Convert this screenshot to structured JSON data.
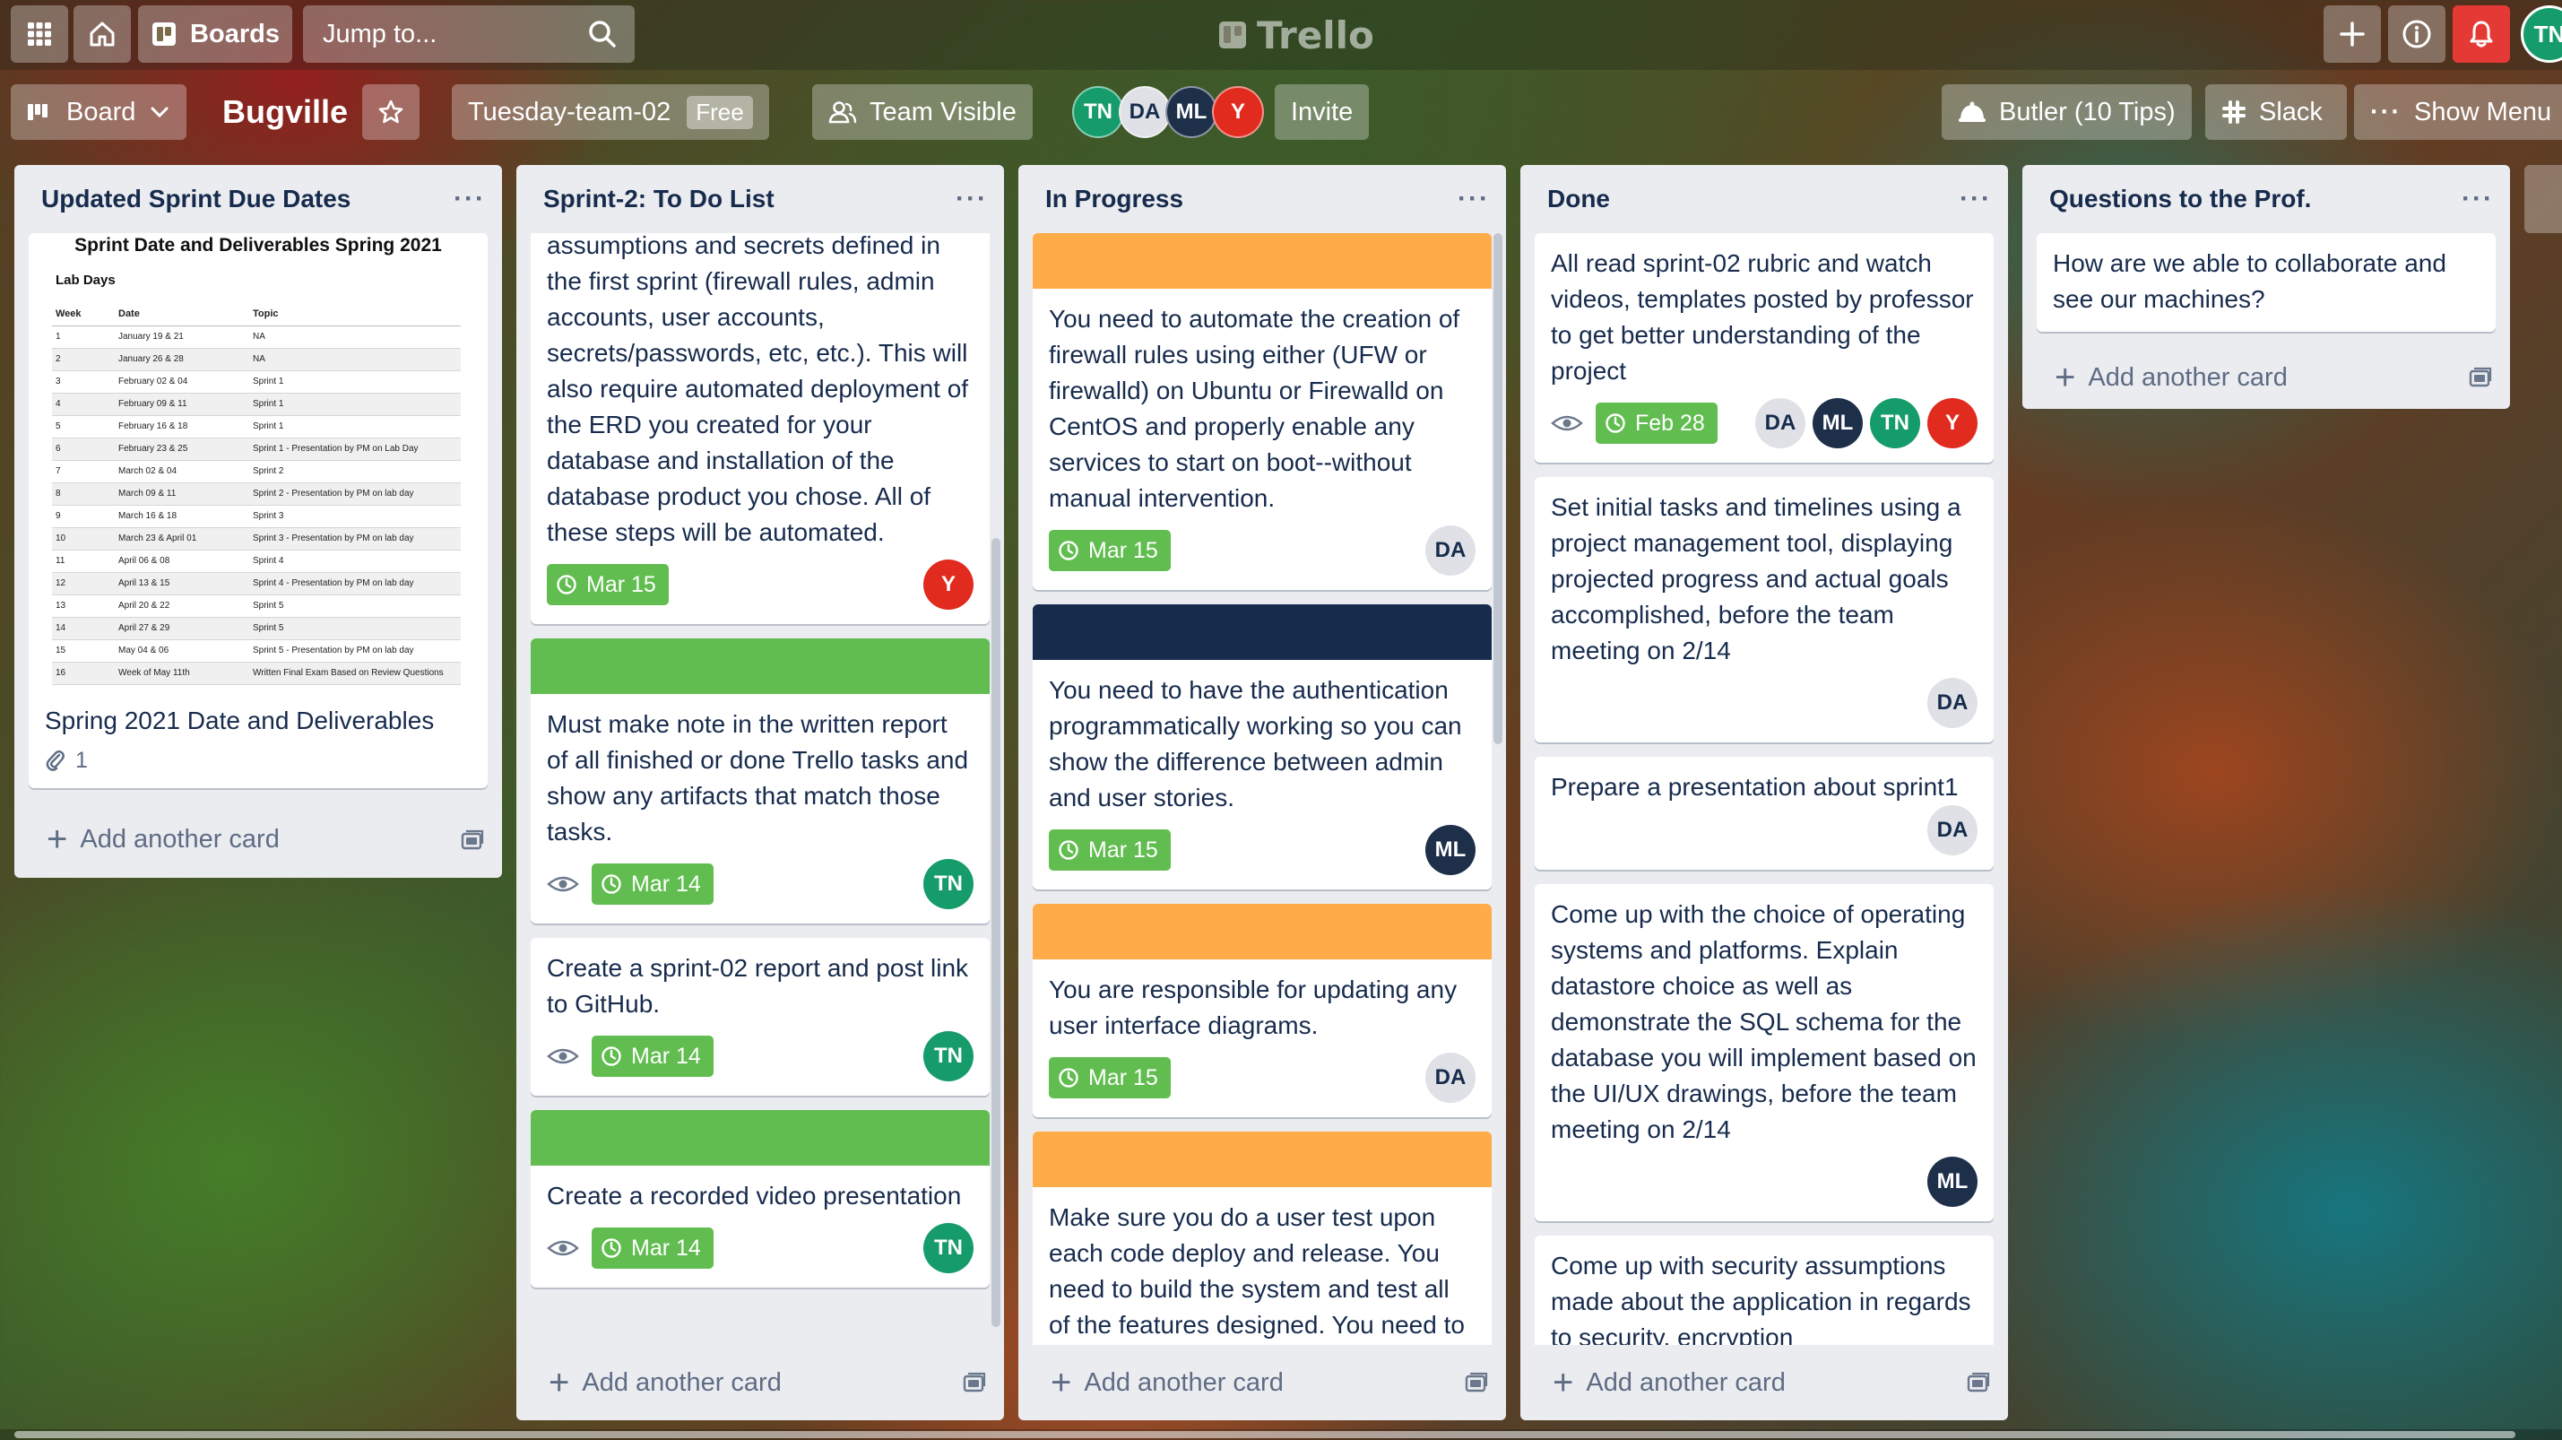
{
  "header": {
    "boards_label": "Boards",
    "search_placeholder": "Jump to...",
    "logo_text": "Trello",
    "user_initials": "TN"
  },
  "board": {
    "view_label": "Board",
    "name": "Bugville",
    "team_name": "Tuesday-team-02",
    "team_plan": "Free",
    "visibility": "Team Visible",
    "members": [
      {
        "initials": "TN",
        "color": "#169c6a"
      },
      {
        "initials": "DA",
        "color": "#dfe1e6"
      },
      {
        "initials": "ML",
        "color": "#1e2f4a"
      },
      {
        "initials": "Y",
        "color": "#e02b1e"
      }
    ],
    "invite_label": "Invite",
    "butler_label": "Butler (10 Tips)",
    "slack_label": "Slack",
    "menu_label": "Show Menu"
  },
  "colors": {
    "label_orange": "#ffab4a",
    "label_navy": "#172b4d",
    "label_green": "#61bd4f",
    "due_green": "#61bd4f",
    "avatar_tn": "#169c6a",
    "avatar_ml": "#1e2f4a",
    "avatar_y": "#e02b1e",
    "avatar_da": "#dfe1e6"
  },
  "lists": [
    {
      "title": "Updated Sprint Due Dates",
      "add_label": "Add another card",
      "schedule": {
        "title": "Sprint Date and Deliverables Spring 2021",
        "subtitle": "Lab Days",
        "columns": [
          "Week",
          "Date",
          "Topic"
        ],
        "rows": [
          [
            "1",
            "January 19 & 21",
            "NA"
          ],
          [
            "2",
            "January 26 & 28",
            "NA"
          ],
          [
            "3",
            "February 02 & 04",
            "Sprint 1"
          ],
          [
            "4",
            "February 09 & 11",
            "Sprint 1"
          ],
          [
            "5",
            "February 16 & 18",
            "Sprint 1"
          ],
          [
            "6",
            "February 23 & 25",
            "Sprint 1 - Presentation by PM on Lab Day"
          ],
          [
            "7",
            "March 02 & 04",
            "Sprint 2"
          ],
          [
            "8",
            "March 09 & 11",
            "Sprint 2 - Presentation by PM on lab day"
          ],
          [
            "9",
            "March 16 & 18",
            "Sprint 3"
          ],
          [
            "10",
            "March 23 & April 01",
            "Sprint 3 - Presentation by PM on lab day"
          ],
          [
            "11",
            "April 06 & 08",
            "Sprint 4"
          ],
          [
            "12",
            "April 13 & 15",
            "Sprint 4 - Presentation by PM on lab day"
          ],
          [
            "13",
            "April 20 & 22",
            "Sprint 5"
          ],
          [
            "14",
            "April 27 & 29",
            "Sprint 5"
          ],
          [
            "15",
            "May 04 & 06",
            "Sprint 5 - Presentation by PM on lab day"
          ],
          [
            "16",
            "Week of May 11th",
            "Written Final Exam Based on Review Questions"
          ]
        ]
      },
      "card_title": "Spring 2021 Date and Deliverables",
      "attachments": "1"
    },
    {
      "title": "Sprint-2: To Do List",
      "add_label": "Add another card",
      "cards": [
        {
          "text": "assumptions and secrets defined in the first sprint (firewall rules, admin accounts, user accounts, secrets/passwords, etc, etc.). This will also require automated deployment of the ERD you created for your database and installation of the database product you chose. All of these steps will be automated.",
          "due": "Mar 15",
          "member": "Y"
        },
        {
          "text": "Must make note in the written report of all finished or done Trello tasks and show any artifacts that match those tasks.",
          "due": "Mar 14",
          "member": "TN"
        },
        {
          "text": "Create a sprint-02 report and post link to GitHub.",
          "due": "Mar 14",
          "member": "TN"
        },
        {
          "text": "Create a recorded video presentation",
          "due": "Mar 14",
          "member": "TN"
        }
      ]
    },
    {
      "title": "In Progress",
      "add_label": "Add another card",
      "cards": [
        {
          "text": "You need to automate the creation of firewall rules using either (UFW or firewalld) on Ubuntu or Firewalld on CentOS and properly enable any services to start on boot--without manual intervention.",
          "due": "Mar 15",
          "member": "DA"
        },
        {
          "text": "You need to have the authentication programmatically working so you can show the difference between admin and user stories.",
          "due": "Mar 15",
          "member": "ML"
        },
        {
          "text": "You are responsible for updating any user interface diagrams.",
          "due": "Mar 15",
          "member": "DA"
        },
        {
          "text": "Make sure you do a user test upon each code deploy and release. You need to build the system and test all of the features designed. You need to confirm that all designed"
        }
      ]
    },
    {
      "title": "Done",
      "add_label": "Add another card",
      "cards": [
        {
          "text": "All read sprint-02 rubric and watch videos, templates posted by professor to get better understanding of the project",
          "due": "Feb 28",
          "members": [
            "DA",
            "ML",
            "TN",
            "Y"
          ]
        },
        {
          "text": "Set initial tasks and timelines using a project management tool, displaying projected progress and actual goals accomplished, before the team meeting on 2/14",
          "member": "DA"
        },
        {
          "text": "Prepare a presentation about sprint1",
          "member": "DA"
        },
        {
          "text": "Come up with the choice of operating systems and platforms. Explain datastore choice as well as demonstrate the SQL schema for the database you will implement based on the UI/UX drawings, before the team meeting on 2/14",
          "member": "ML"
        },
        {
          "text": "Come up with security assumptions made about the application in regards to security, encryption"
        }
      ]
    },
    {
      "title": "Questions to the Prof.",
      "add_label": "Add another card",
      "cards": [
        {
          "text": "How are we able to collaborate and see our machines?"
        }
      ]
    }
  ]
}
